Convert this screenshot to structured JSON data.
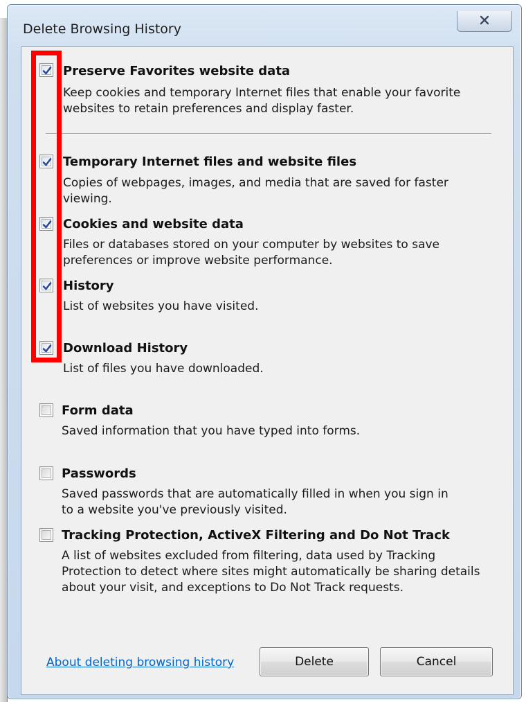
{
  "dialog": {
    "title": "Delete Browsing History",
    "close_icon": "close-icon"
  },
  "options": [
    {
      "key": "preserve-favorites",
      "checked": true,
      "title": "Preserve Favorites website data",
      "description": "Keep cookies and temporary Internet files that enable your favorite websites to retain preferences and display faster."
    },
    {
      "key": "temporary-internet-files",
      "checked": true,
      "title": "Temporary Internet files and website files",
      "description": "Copies of webpages, images, and media that are saved for faster viewing."
    },
    {
      "key": "cookies",
      "checked": true,
      "title": "Cookies and website data",
      "description": "Files or databases stored on your computer by websites to save preferences or improve website performance."
    },
    {
      "key": "history",
      "checked": true,
      "title": "History",
      "description": "List of websites you have visited."
    },
    {
      "key": "download-history",
      "checked": true,
      "title": "Download History",
      "description": "List of files you have downloaded."
    },
    {
      "key": "form-data",
      "checked": false,
      "title": "Form data",
      "description": "Saved information that you have typed into forms."
    },
    {
      "key": "passwords",
      "checked": false,
      "title": "Passwords",
      "description": "Saved passwords that are automatically filled in when you sign in to a website you've previously visited."
    },
    {
      "key": "tracking-protection",
      "checked": false,
      "title": "Tracking Protection, ActiveX Filtering and Do Not Track",
      "description": "A list of websites excluded from filtering, data used by Tracking Protection to detect where sites might automatically be sharing details about your visit, and exceptions to Do Not Track requests."
    }
  ],
  "footer": {
    "link": "About deleting browsing history",
    "delete_label": "Delete",
    "cancel_label": "Cancel"
  },
  "colors": {
    "highlight": "#ff0000",
    "link": "#0066cc",
    "checkmark": "#2a4a9c"
  }
}
